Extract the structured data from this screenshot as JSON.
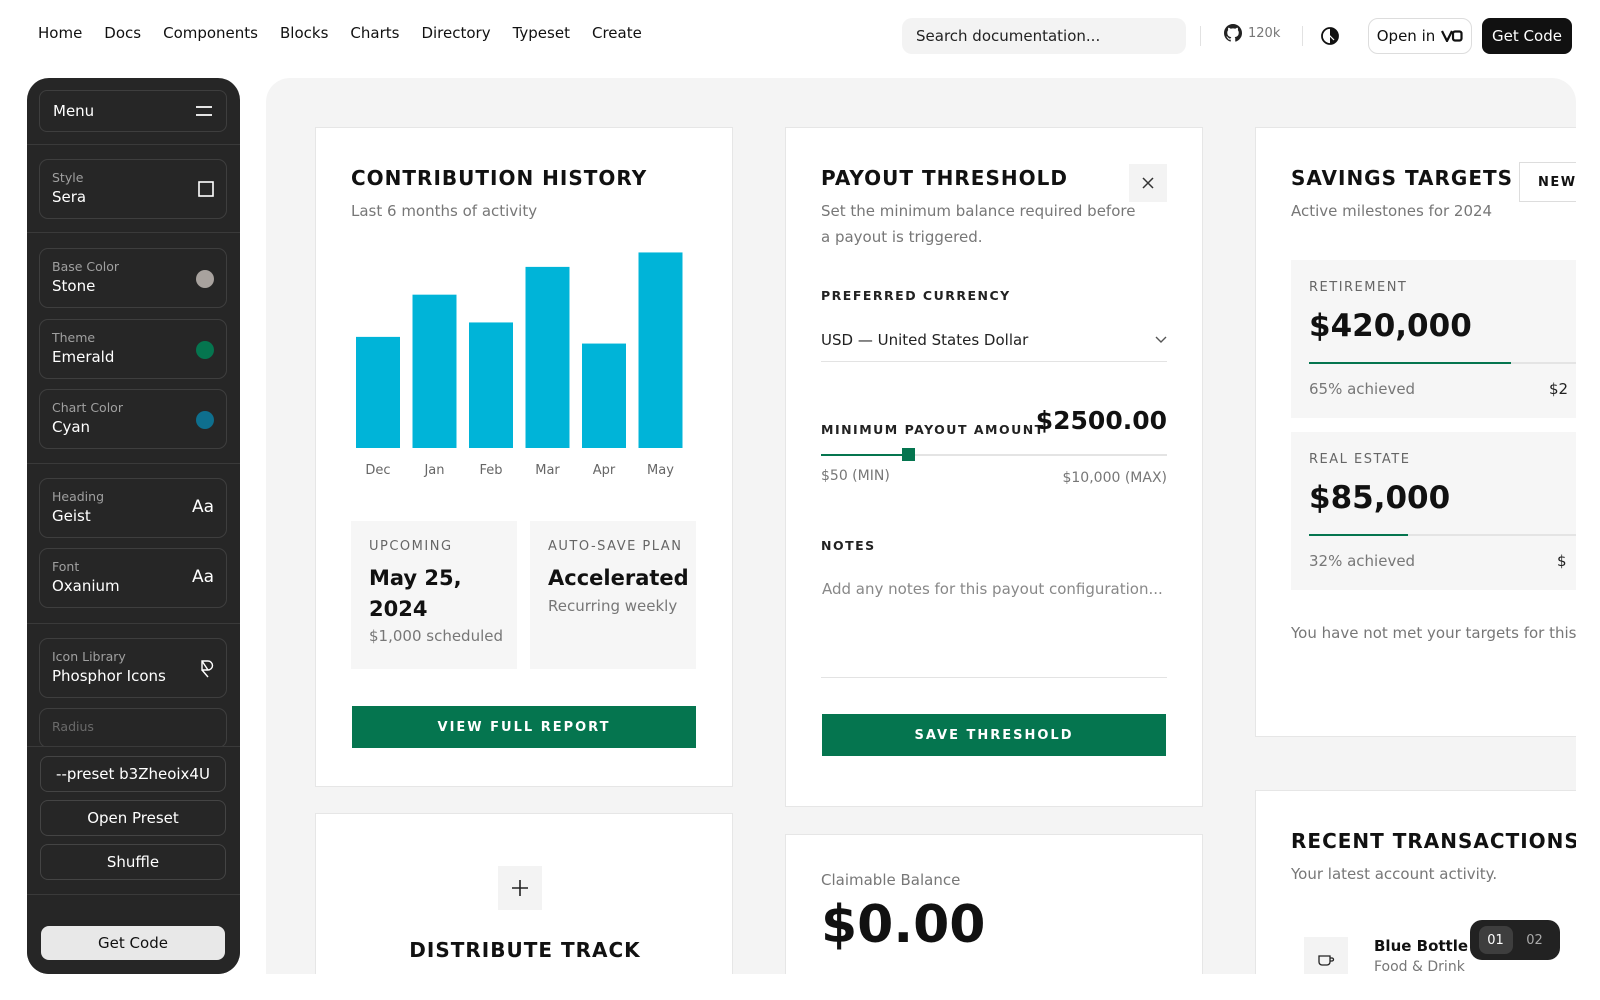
{
  "nav": {
    "links": [
      "Home",
      "Docs",
      "Components",
      "Blocks",
      "Charts",
      "Directory",
      "Typeset",
      "Create"
    ],
    "search_placeholder": "Search documentation...",
    "github_stars": "120k",
    "open_in_label": "Open in",
    "get_code_label": "Get Code"
  },
  "sidebar": {
    "menu_label": "Menu",
    "items": [
      {
        "label": "Style",
        "value": "Sera",
        "icon": "square-icon"
      },
      {
        "label": "Base Color",
        "value": "Stone",
        "icon": "color-dot-icon",
        "color": "#a8a29e"
      },
      {
        "label": "Theme",
        "value": "Emerald",
        "icon": "color-dot-icon",
        "color": "#05754f"
      },
      {
        "label": "Chart Color",
        "value": "Cyan",
        "icon": "color-dot-icon",
        "color": "#0e6f8e"
      },
      {
        "label": "Heading",
        "value": "Geist",
        "icon": "font-icon",
        "glyph": "Aa"
      },
      {
        "label": "Font",
        "value": "Oxanium",
        "icon": "font-icon",
        "glyph": "Aa"
      },
      {
        "label": "Icon Library",
        "value": "Phosphor Icons",
        "icon": "phosphor-icon"
      },
      {
        "label": "Radius",
        "value": "",
        "icon": ""
      }
    ],
    "preset_label": "--preset b3Zheoix4U",
    "open_preset_label": "Open Preset",
    "shuffle_label": "Shuffle",
    "get_code_label": "Get Code"
  },
  "contribution": {
    "title": "CONTRIBUTION HISTORY",
    "subtitle": "Last 6 months of activity",
    "upcoming_label": "UPCOMING",
    "upcoming_date": "May 25, 2024",
    "upcoming_note": "$1,000 scheduled",
    "autosave_label": "AUTO-SAVE PLAN",
    "autosave_value": "Accelerated",
    "autosave_note": "Recurring weekly",
    "button_label": "VIEW FULL REPORT"
  },
  "chart_data": {
    "type": "bar",
    "categories": [
      "Dec",
      "Jan",
      "Feb",
      "Mar",
      "Apr",
      "May"
    ],
    "values": [
      100,
      138,
      113,
      163,
      94,
      176
    ],
    "ylim": [
      0,
      180
    ],
    "color": "#00b4d8",
    "title": "",
    "xlabel": "",
    "ylabel": ""
  },
  "payout": {
    "title": "PAYOUT THRESHOLD",
    "subtitle_line1": "Set the minimum balance required before",
    "subtitle_line2": "a payout is triggered.",
    "currency_label": "PREFERRED CURRENCY",
    "currency_value": "USD — United States Dollar",
    "min_label": "MINIMUM PAYOUT AMOUNT",
    "min_value": "$2500.00",
    "slider_fraction": 0.25,
    "min_bound": "$50 (MIN)",
    "max_bound": "$10,000 (MAX)",
    "notes_label": "NOTES",
    "notes_placeholder": "Add any notes for this payout configuration...",
    "button_label": "SAVE THRESHOLD"
  },
  "savings": {
    "title": "SAVINGS TARGETS",
    "new_label": "NEW",
    "subtitle": "Active milestones for 2024",
    "targets": [
      {
        "label": "RETIREMENT",
        "amount": "$420,000",
        "progress": 0.65,
        "achieved": "65% achieved",
        "right": "$2"
      },
      {
        "label": "REAL ESTATE",
        "amount": "$85,000",
        "progress": 0.32,
        "achieved": "32% achieved",
        "right": "$"
      }
    ],
    "footer": "You have not met your targets for this y"
  },
  "distribute": {
    "title": "DISTRIBUTE TRACK"
  },
  "claimable": {
    "label": "Claimable Balance",
    "value": "$0.00"
  },
  "transactions": {
    "title": "RECENT TRANSACTIONS",
    "subtitle": "Your latest account activity.",
    "item_name": "Blue Bottle C",
    "item_category": "Food & Drink"
  },
  "pager": [
    "01",
    "02"
  ],
  "colors": {
    "accent": "#05754f",
    "chart": "#00b4d8",
    "sidebar": "#262626"
  }
}
